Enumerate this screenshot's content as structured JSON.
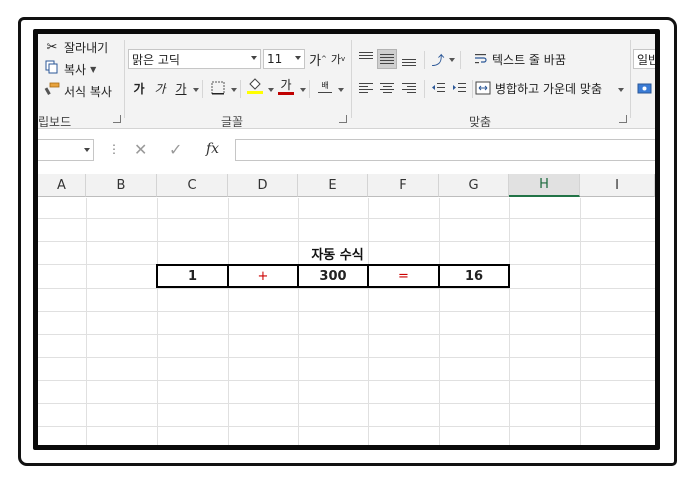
{
  "clipboard": {
    "cut_label": "잘라내기",
    "copy_label": "복사",
    "format_painter_label": "서식 복사",
    "group_label": "립보드"
  },
  "font": {
    "name": "맑은 고딕",
    "size": "11",
    "grow_label": "가",
    "shrink_label": "가",
    "bold_label": "가",
    "italic_label": "가",
    "underline_label": "가",
    "highlight_color": "#ffff00",
    "font_color": "#c00000",
    "font_color_label": "가",
    "phonetic_label": "배",
    "group_label": "글꼴"
  },
  "alignment": {
    "wrap_text_label": "텍스트 줄 바꿈",
    "merge_center_label": "병합하고 가운데 맞춤",
    "group_label": "맞춤"
  },
  "number": {
    "format_partial": "일반"
  },
  "formula_bar": {
    "name_box_value": "",
    "formula_value": "",
    "cancel_icon": "✕",
    "enter_icon": "✓",
    "fx_label": "fx",
    "dots": "⋮"
  },
  "sheet": {
    "columns": [
      "A",
      "B",
      "C",
      "D",
      "E",
      "F",
      "G",
      "H",
      "I"
    ],
    "selected_column": "H",
    "title": "자동 수식",
    "row_values": [
      "1",
      "+",
      "300",
      "=",
      "16"
    ]
  },
  "colors": {
    "accent": "#217346",
    "operator": "#cc0000"
  }
}
